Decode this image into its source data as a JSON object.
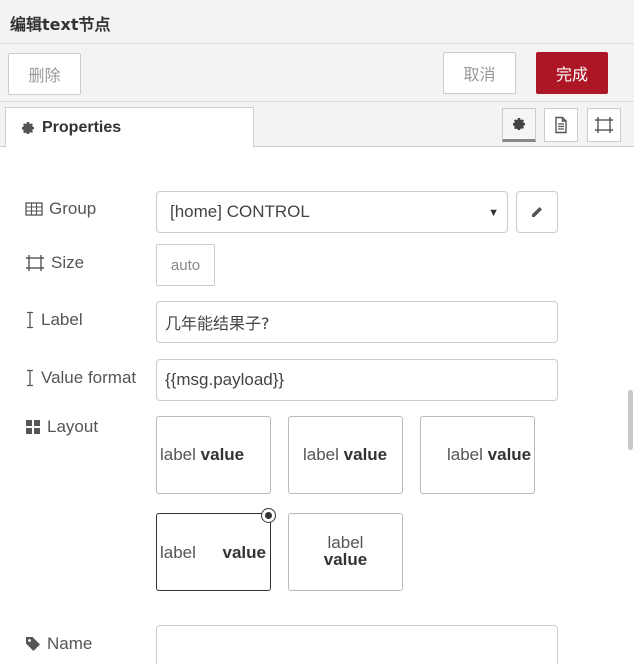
{
  "header": {
    "title": "编辑text节点"
  },
  "buttons": {
    "delete": "删除",
    "cancel": "取消",
    "done": "完成"
  },
  "colors": {
    "primary": "#ad1625"
  },
  "tabs": {
    "properties": "Properties"
  },
  "tab_icons": [
    "gear-icon",
    "document-icon",
    "frame-icon"
  ],
  "form": {
    "group": {
      "label": "Group",
      "value": "[home] CONTROL"
    },
    "size": {
      "label": "Size",
      "value": "auto"
    },
    "label": {
      "label": "Label",
      "value": "几年能结果子?"
    },
    "format": {
      "label": "Value format",
      "value": "{{msg.payload}}"
    },
    "layout": {
      "label": "Layout",
      "selected_index": 3,
      "options": [
        {
          "label": "label",
          "value": "value"
        },
        {
          "label": "label",
          "value": "value"
        },
        {
          "label": "label",
          "value": "value"
        },
        {
          "label": "label",
          "value": "value"
        },
        {
          "label": "label",
          "value": "value"
        }
      ]
    },
    "name": {
      "label": "Name",
      "value": ""
    }
  }
}
